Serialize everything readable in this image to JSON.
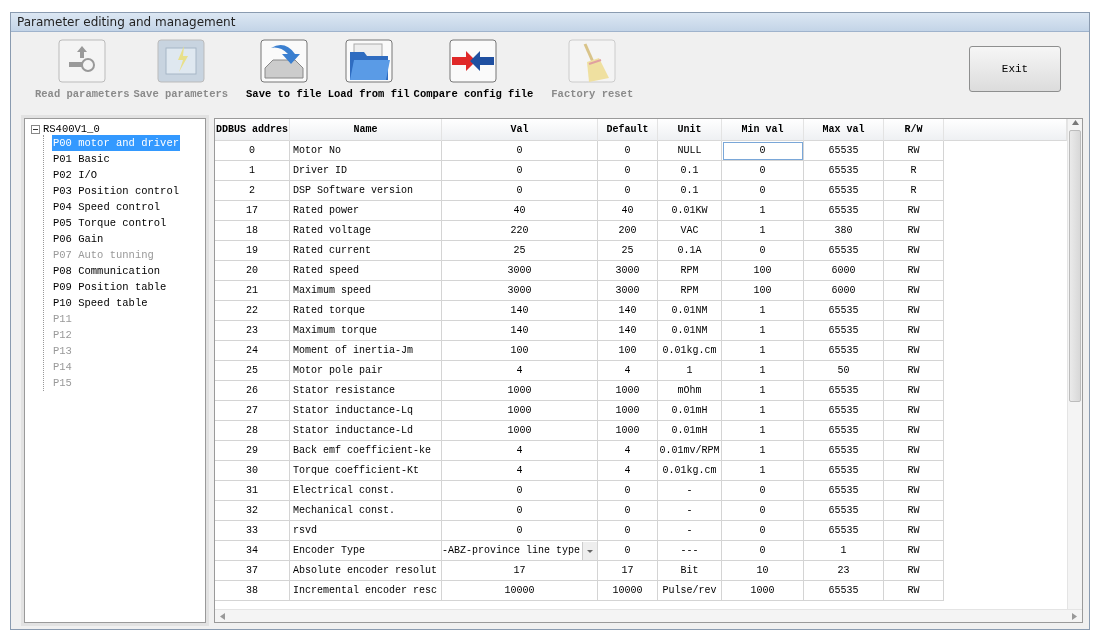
{
  "window": {
    "title": "Parameter editing and management"
  },
  "toolbar": [
    {
      "label": "Read parameters",
      "kind": "read",
      "disabled": true
    },
    {
      "label": "Save parameters",
      "kind": "save",
      "disabled": true
    },
    {
      "label": "Save to file",
      "kind": "savefile",
      "disabled": false
    },
    {
      "label": "Load from fil",
      "kind": "load",
      "disabled": false
    },
    {
      "label": "Compare config file",
      "kind": "compare",
      "disabled": false
    },
    {
      "label": "Factory reset",
      "kind": "reset",
      "disabled": true
    }
  ],
  "exit_button": "Exit",
  "tree": {
    "label": "RS400V1_0",
    "expanded": true,
    "children": [
      {
        "label": "P00 motor and driver",
        "selected": true,
        "disabled": false
      },
      {
        "label": "P01 Basic",
        "selected": false,
        "disabled": false
      },
      {
        "label": "P02 I/O",
        "selected": false,
        "disabled": false
      },
      {
        "label": "P03 Position control",
        "selected": false,
        "disabled": false
      },
      {
        "label": "P04 Speed control",
        "selected": false,
        "disabled": false
      },
      {
        "label": "P05 Torque control",
        "selected": false,
        "disabled": false
      },
      {
        "label": "P06 Gain",
        "selected": false,
        "disabled": false
      },
      {
        "label": "P07 Auto tunning",
        "selected": false,
        "disabled": true
      },
      {
        "label": "P08 Communication",
        "selected": false,
        "disabled": false
      },
      {
        "label": "P09 Position table",
        "selected": false,
        "disabled": false
      },
      {
        "label": "P10 Speed table",
        "selected": false,
        "disabled": false
      },
      {
        "label": "P11",
        "selected": false,
        "disabled": true
      },
      {
        "label": "P12",
        "selected": false,
        "disabled": true
      },
      {
        "label": "P13",
        "selected": false,
        "disabled": true
      },
      {
        "label": "P14",
        "selected": false,
        "disabled": true
      },
      {
        "label": "P15",
        "selected": false,
        "disabled": true
      }
    ]
  },
  "table": {
    "columns": [
      "DDBUS addres",
      "Name",
      "Val",
      "Default",
      "Unit",
      "Min val",
      "Max val",
      "R/W"
    ],
    "rows": [
      {
        "address": "0",
        "name": "Motor No",
        "val": "0",
        "val_dropdown": false,
        "default": "0",
        "unit": "NULL",
        "min": "0",
        "min_selected": true,
        "max": "65535",
        "rw": "RW"
      },
      {
        "address": "1",
        "name": "Driver ID",
        "val": "0",
        "val_dropdown": false,
        "default": "0",
        "unit": "0.1",
        "min": "0",
        "min_selected": false,
        "max": "65535",
        "rw": "R"
      },
      {
        "address": "2",
        "name": "DSP Software version",
        "val": "0",
        "val_dropdown": false,
        "default": "0",
        "unit": "0.1",
        "min": "0",
        "min_selected": false,
        "max": "65535",
        "rw": "R"
      },
      {
        "address": "17",
        "name": "Rated power",
        "val": "40",
        "val_dropdown": false,
        "default": "40",
        "unit": "0.01KW",
        "min": "1",
        "min_selected": false,
        "max": "65535",
        "rw": "RW"
      },
      {
        "address": "18",
        "name": "Rated voltage",
        "val": "220",
        "val_dropdown": false,
        "default": "200",
        "unit": "VAC",
        "min": "1",
        "min_selected": false,
        "max": "380",
        "rw": "RW"
      },
      {
        "address": "19",
        "name": "Rated current",
        "val": "25",
        "val_dropdown": false,
        "default": "25",
        "unit": "0.1A",
        "min": "0",
        "min_selected": false,
        "max": "65535",
        "rw": "RW"
      },
      {
        "address": "20",
        "name": "Rated speed",
        "val": "3000",
        "val_dropdown": false,
        "default": "3000",
        "unit": "RPM",
        "min": "100",
        "min_selected": false,
        "max": "6000",
        "rw": "RW"
      },
      {
        "address": "21",
        "name": "Maximum speed",
        "val": "3000",
        "val_dropdown": false,
        "default": "3000",
        "unit": "RPM",
        "min": "100",
        "min_selected": false,
        "max": "6000",
        "rw": "RW"
      },
      {
        "address": "22",
        "name": "Rated torque",
        "val": "140",
        "val_dropdown": false,
        "default": "140",
        "unit": "0.01NM",
        "min": "1",
        "min_selected": false,
        "max": "65535",
        "rw": "RW"
      },
      {
        "address": "23",
        "name": "Maximum torque",
        "val": "140",
        "val_dropdown": false,
        "default": "140",
        "unit": "0.01NM",
        "min": "1",
        "min_selected": false,
        "max": "65535",
        "rw": "RW"
      },
      {
        "address": "24",
        "name": "Moment of inertia-Jm",
        "val": "100",
        "val_dropdown": false,
        "default": "100",
        "unit": "0.01kg.cm",
        "min": "1",
        "min_selected": false,
        "max": "65535",
        "rw": "RW"
      },
      {
        "address": "25",
        "name": "Motor pole pair",
        "val": "4",
        "val_dropdown": false,
        "default": "4",
        "unit": "1",
        "min": "1",
        "min_selected": false,
        "max": "50",
        "rw": "RW"
      },
      {
        "address": "26",
        "name": "Stator resistance",
        "val": "1000",
        "val_dropdown": false,
        "default": "1000",
        "unit": "mOhm",
        "min": "1",
        "min_selected": false,
        "max": "65535",
        "rw": "RW"
      },
      {
        "address": "27",
        "name": "Stator inductance-Lq",
        "val": "1000",
        "val_dropdown": false,
        "default": "1000",
        "unit": "0.01mH",
        "min": "1",
        "min_selected": false,
        "max": "65535",
        "rw": "RW"
      },
      {
        "address": "28",
        "name": "Stator inductance-Ld",
        "val": "1000",
        "val_dropdown": false,
        "default": "1000",
        "unit": "0.01mH",
        "min": "1",
        "min_selected": false,
        "max": "65535",
        "rw": "RW"
      },
      {
        "address": "29",
        "name": "Back emf coefficient-ke",
        "val": "4",
        "val_dropdown": false,
        "default": "4",
        "unit": "0.01mv/RPM",
        "min": "1",
        "min_selected": false,
        "max": "65535",
        "rw": "RW"
      },
      {
        "address": "30",
        "name": "Torque coefficient-Kt",
        "val": "4",
        "val_dropdown": false,
        "default": "4",
        "unit": "0.01kg.cm",
        "min": "1",
        "min_selected": false,
        "max": "65535",
        "rw": "RW"
      },
      {
        "address": "31",
        "name": "Electrical const.",
        "val": "0",
        "val_dropdown": false,
        "default": "0",
        "unit": "-",
        "min": "0",
        "min_selected": false,
        "max": "65535",
        "rw": "RW"
      },
      {
        "address": "32",
        "name": "Mechanical const.",
        "val": "0",
        "val_dropdown": false,
        "default": "0",
        "unit": "-",
        "min": "0",
        "min_selected": false,
        "max": "65535",
        "rw": "RW"
      },
      {
        "address": "33",
        "name": "rsvd",
        "val": "0",
        "val_dropdown": false,
        "default": "0",
        "unit": "-",
        "min": "0",
        "min_selected": false,
        "max": "65535",
        "rw": "RW"
      },
      {
        "address": "34",
        "name": "Encoder Type",
        "val": "-ABZ-province line type",
        "val_dropdown": true,
        "default": "0",
        "unit": "---",
        "min": "0",
        "min_selected": false,
        "max": "1",
        "rw": "RW"
      },
      {
        "address": "37",
        "name": "Absolute encoder resolut",
        "val": "17",
        "val_dropdown": false,
        "default": "17",
        "unit": "Bit",
        "min": "10",
        "min_selected": false,
        "max": "23",
        "rw": "RW"
      },
      {
        "address": "38",
        "name": "Incremental encoder resc",
        "val": "10000",
        "val_dropdown": false,
        "default": "10000",
        "unit": "Pulse/rev",
        "min": "1000",
        "min_selected": false,
        "max": "65535",
        "rw": "RW"
      }
    ]
  }
}
